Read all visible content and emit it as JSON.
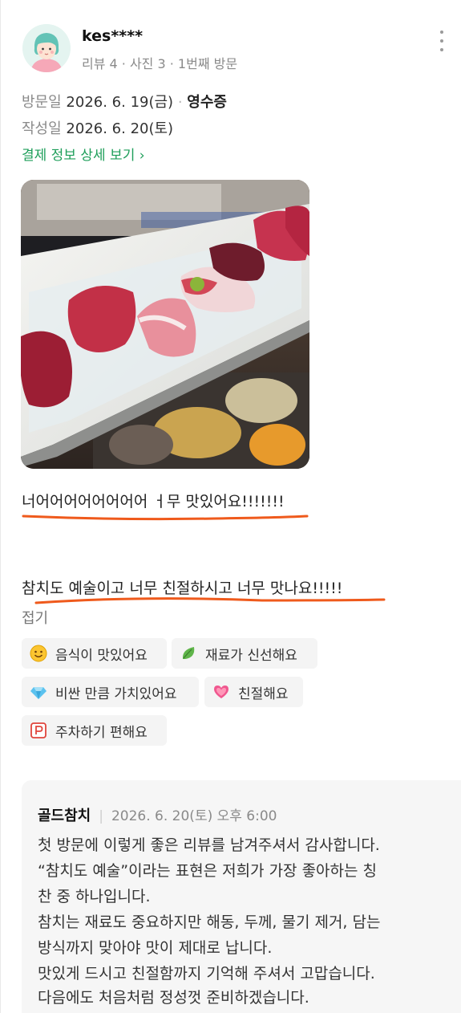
{
  "review": {
    "author": "kes****",
    "meta": "리뷰 4 · 사진 3 · 1번째 방문",
    "visit_label": "방문일",
    "visit_date": "2026. 6. 19(금)",
    "receipt_label": "영수증",
    "written_label": "작성일",
    "written_date": "2026. 6. 20(토)",
    "payment_link": "결제 정보 상세 보기",
    "photo_alt": "참치 회 플레이트",
    "text_line1": "너어어어어어어어어 ㅓ무 맛있어요!!!!!!!",
    "text_line2": "참치도 예술이고 너무 친절하시고 너무 맛나요!!!!!",
    "fold_label": "접기",
    "underline_color": "#ef5a1c"
  },
  "keywords": [
    {
      "icon": "smile-emoji-icon",
      "label": "음식이 맛있어요"
    },
    {
      "icon": "leaf-icon",
      "label": "재료가 신선해요"
    },
    {
      "icon": "gem-icon",
      "label": "비싼 만큼 가치있어요"
    },
    {
      "icon": "heart-icon",
      "label": "친절해요"
    },
    {
      "icon": "parking-icon",
      "label": "주차하기 편해요"
    }
  ],
  "reply": {
    "owner": "골드참치",
    "date": "2026. 6. 20(토) 오후 6:00",
    "lines": [
      "첫 방문에 이렇게 좋은 리뷰를 남겨주셔서 감사합니다.",
      "“참치도 예술”이라는 표현은 저희가 가장 좋아하는 칭",
      "찬 중 하나입니다.",
      "참치는 재료도 중요하지만 해동, 두께, 물기 제거, 담는",
      "방식까지 맞아야 맛이 제대로 납니다.",
      "맛있게 드시고 친절함까지 기억해 주셔서 고맙습니다.",
      "다음에도 처음처럼 정성껏 준비하겠습니다."
    ]
  },
  "colors": {
    "link_green": "#1e9e5a",
    "chip_bg": "#f4f4f4",
    "reply_bg": "#f6f6f6"
  }
}
